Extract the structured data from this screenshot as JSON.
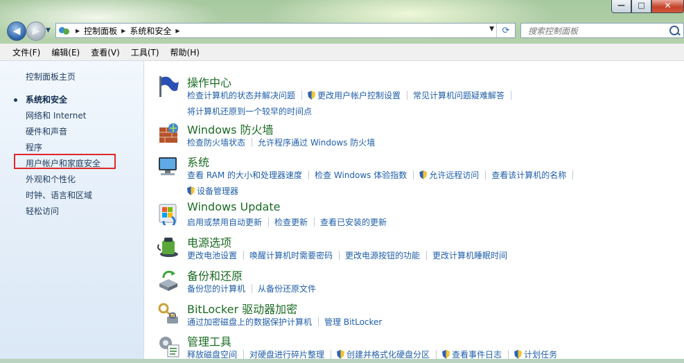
{
  "address": {
    "crumbs": [
      "控制面板",
      "系统和安全"
    ],
    "search_placeholder": "搜索控制面板"
  },
  "caption": {
    "minimize": "—",
    "maximize": "□",
    "close": "✕"
  },
  "menu": [
    "文件(F)",
    "编辑(E)",
    "查看(V)",
    "工具(T)",
    "帮助(H)"
  ],
  "left_pane": {
    "items": [
      "控制面板主页",
      "系统和安全",
      "网络和 Internet",
      "硬件和声音",
      "程序",
      "用户帐户和家庭安全",
      "外观和个性化",
      "时钟、语言和区域",
      "轻松访问"
    ],
    "current": "系统和安全",
    "highlighted": "用户帐户和家庭安全"
  },
  "categories": [
    {
      "title": "操作中心",
      "icon": "action-center-flag-icon",
      "links": [
        "检查计算机的状态并解决问题",
        "更改用户帐户控制设置",
        "常见计算机问题疑难解答",
        "将计算机还原到一个较早的时间点"
      ]
    },
    {
      "title": "Windows 防火墙",
      "icon": "firewall-icon",
      "links": [
        "检查防火墙状态",
        "允许程序通过 Windows 防火墙"
      ]
    },
    {
      "title": "系统",
      "icon": "system-computer-icon",
      "links": [
        "查看 RAM 的大小和处理器速度",
        "检查 Windows 体验指数",
        "允许远程访问",
        "查看该计算机的名称",
        "设备管理器"
      ]
    },
    {
      "title": "Windows Update",
      "icon": "windows-update-icon",
      "links": [
        "启用或禁用自动更新",
        "检查更新",
        "查看已安装的更新"
      ]
    },
    {
      "title": "电源选项",
      "icon": "power-options-icon",
      "links": [
        "更改电池设置",
        "唤醒计算机时需要密码",
        "更改电源按钮的功能",
        "更改计算机睡眠时间"
      ]
    },
    {
      "title": "备份和还原",
      "icon": "backup-restore-icon",
      "links": [
        "备份您的计算机",
        "从备份还原文件"
      ]
    },
    {
      "title": "BitLocker 驱动器加密",
      "icon": "bitlocker-icon",
      "links": [
        "通过加密磁盘上的数据保护计算机",
        "管理 BitLocker"
      ]
    },
    {
      "title": "管理工具",
      "icon": "admin-tools-icon",
      "links": [
        "释放磁盘空间",
        "对硬盘进行碎片整理",
        "创建并格式化硬盘分区",
        "查看事件日志",
        "计划任务"
      ]
    }
  ],
  "colors": {
    "title_green": "#1a6b22",
    "link_blue": "#1f5ea8",
    "highlight_red": "#e0262a"
  }
}
